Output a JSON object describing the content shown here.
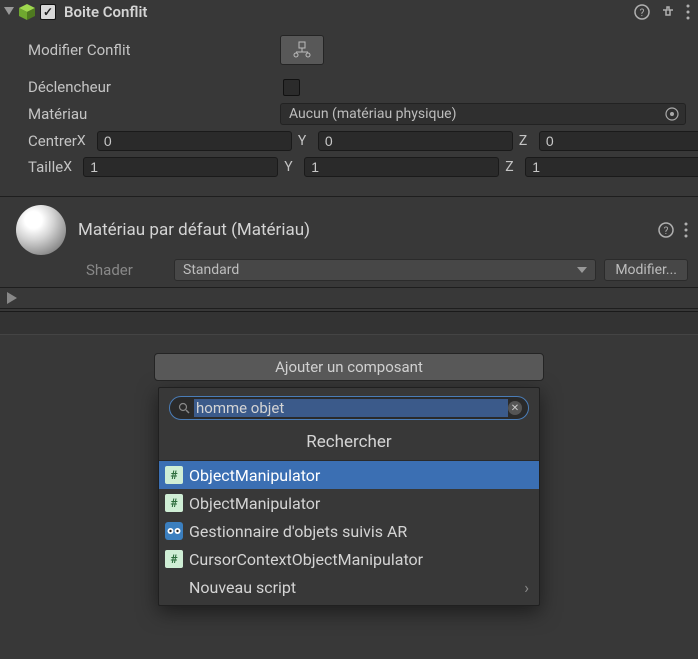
{
  "component": {
    "title": "Boite Conflit",
    "enabled": true,
    "props": {
      "modifier_label": "Modifier Conflit",
      "trigger_label": "Déclencheur",
      "material_label": "Matériau",
      "material_value": "Aucun (matériau physique)",
      "center_label": "Centrer",
      "center": {
        "x": "0",
        "y": "0",
        "z": "0"
      },
      "size_label": "Taille",
      "size": {
        "x": "1",
        "y": "1",
        "z": "1"
      }
    }
  },
  "axis": {
    "x": "X",
    "y": "Y",
    "z": "Z"
  },
  "material": {
    "title": "Matériau par défaut (Matériau)",
    "shader_label": "Shader",
    "shader_value": "Standard",
    "edit_label": "Modifier..."
  },
  "add_component": "Ajouter un composant",
  "popup": {
    "search_value": "homme objet",
    "title": "Rechercher",
    "results": [
      {
        "label": "ObjectManipulator",
        "type": "script"
      },
      {
        "label": "ObjectManipulator",
        "type": "script"
      },
      {
        "label": "Gestionnaire d'objets suivis AR",
        "type": "ar"
      },
      {
        "label": "CursorContextObjectManipulator",
        "type": "script"
      }
    ],
    "new_script": "Nouveau script"
  }
}
